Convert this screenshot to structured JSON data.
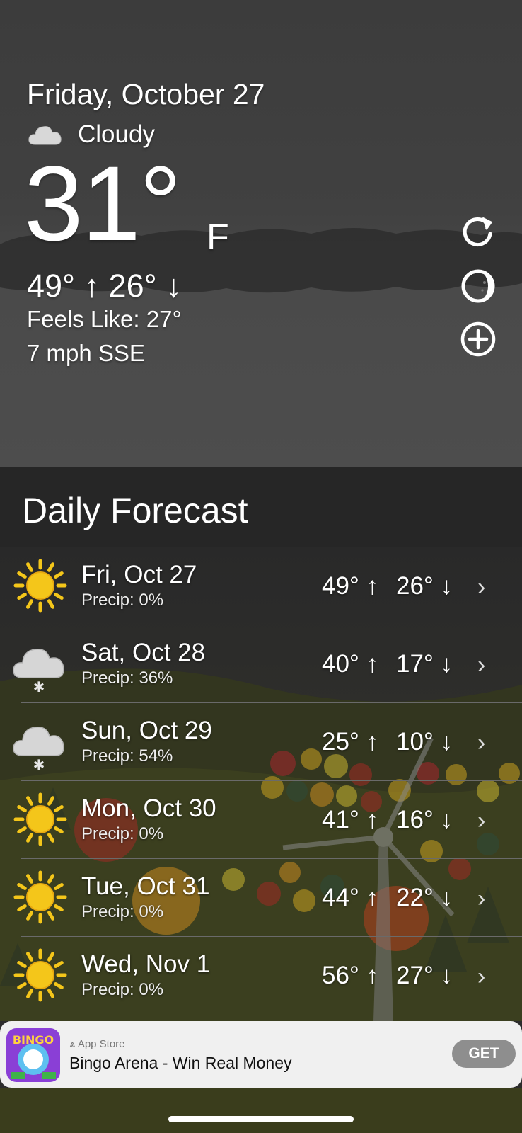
{
  "current": {
    "date": "Friday, October 27",
    "condition": "Cloudy",
    "condition_icon": "cloud-icon",
    "temperature": "31°",
    "unit": "F",
    "hi_lo": "49° ↑  26° ↓",
    "feels_like": "Feels Like: 27°",
    "wind": "7 mph SSE"
  },
  "actions": {
    "refresh_icon": "refresh-icon",
    "moon_icon": "moon-phase-icon",
    "add_icon": "add-circle-icon"
  },
  "forecast": {
    "title": "Daily Forecast",
    "days": [
      {
        "day": "Fri, Oct 27",
        "precip": "Precip: 0%",
        "hi": "49° ↑",
        "lo": "26° ↓",
        "icon": "sun-icon"
      },
      {
        "day": "Sat, Oct 28",
        "precip": "Precip: 36%",
        "hi": "40° ↑",
        "lo": "17° ↓",
        "icon": "snow-cloud-icon"
      },
      {
        "day": "Sun, Oct 29",
        "precip": "Precip: 54%",
        "hi": "25° ↑",
        "lo": "10° ↓",
        "icon": "snow-cloud-icon"
      },
      {
        "day": "Mon, Oct 30",
        "precip": "Precip: 0%",
        "hi": "41° ↑",
        "lo": "16° ↓",
        "icon": "sun-icon"
      },
      {
        "day": "Tue, Oct 31",
        "precip": "Precip: 0%",
        "hi": "44° ↑",
        "lo": "22° ↓",
        "icon": "sun-icon"
      },
      {
        "day": "Wed, Nov 1",
        "precip": "Precip: 0%",
        "hi": "56° ↑",
        "lo": "27° ↓",
        "icon": "sun-icon"
      }
    ],
    "chevron": "›"
  },
  "ad": {
    "source": "App Store",
    "title": "Bingo Arena - Win Real Money",
    "button": "GET",
    "icon_text": "BINGO"
  },
  "colors": {
    "sun": "#f4c61a",
    "hero_bg": "#4d4d4d",
    "list_bg": "#282828"
  }
}
